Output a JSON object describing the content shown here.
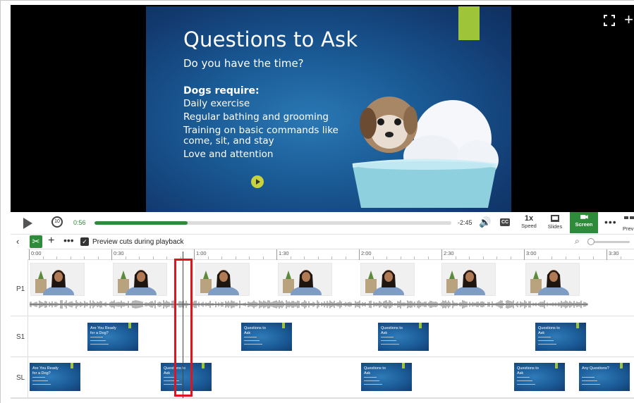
{
  "slide": {
    "title": "Questions to Ask",
    "subtitle": "Do you have the time?",
    "heading": "Dogs require:",
    "bullets": [
      "Daily exercise",
      "Regular bathing and grooming",
      "Training on basic commands like come, sit, and stay",
      "Love and attention"
    ]
  },
  "player": {
    "current_time": "0:56",
    "remaining_time": "-2:45",
    "progress_fraction": 0.26,
    "speed_label": "1x",
    "speed_caption": "Speed",
    "slides_caption": "Slides",
    "screen_caption": "Screen",
    "preview_caption": "Prev",
    "cc_label": "CC"
  },
  "toolbar": {
    "preview_cuts_label": "Preview cuts during playback",
    "preview_cuts_checked": true
  },
  "ruler": {
    "labels": [
      "0:00",
      "0:30",
      "1:00",
      "1:30",
      "2:00",
      "2:30",
      "3:00",
      "3:30"
    ]
  },
  "tracks": [
    {
      "label": "P1"
    },
    {
      "label": "S1"
    },
    {
      "label": "SL"
    }
  ],
  "thumbnails": {
    "s1": [
      "Are You Ready for a Dog?",
      "Questions to Ask",
      "Questions to Ask",
      "Questions to Ask"
    ],
    "sl": [
      "Are You Ready for a Dog?",
      "Questions to Ask",
      "Questions to Ask",
      "Questions to Ask",
      "Any Questions?"
    ]
  },
  "colors": {
    "accent_green": "#2e8b3a",
    "slide_accent": "#9ec43a",
    "cut_marker": "#e0141e"
  }
}
